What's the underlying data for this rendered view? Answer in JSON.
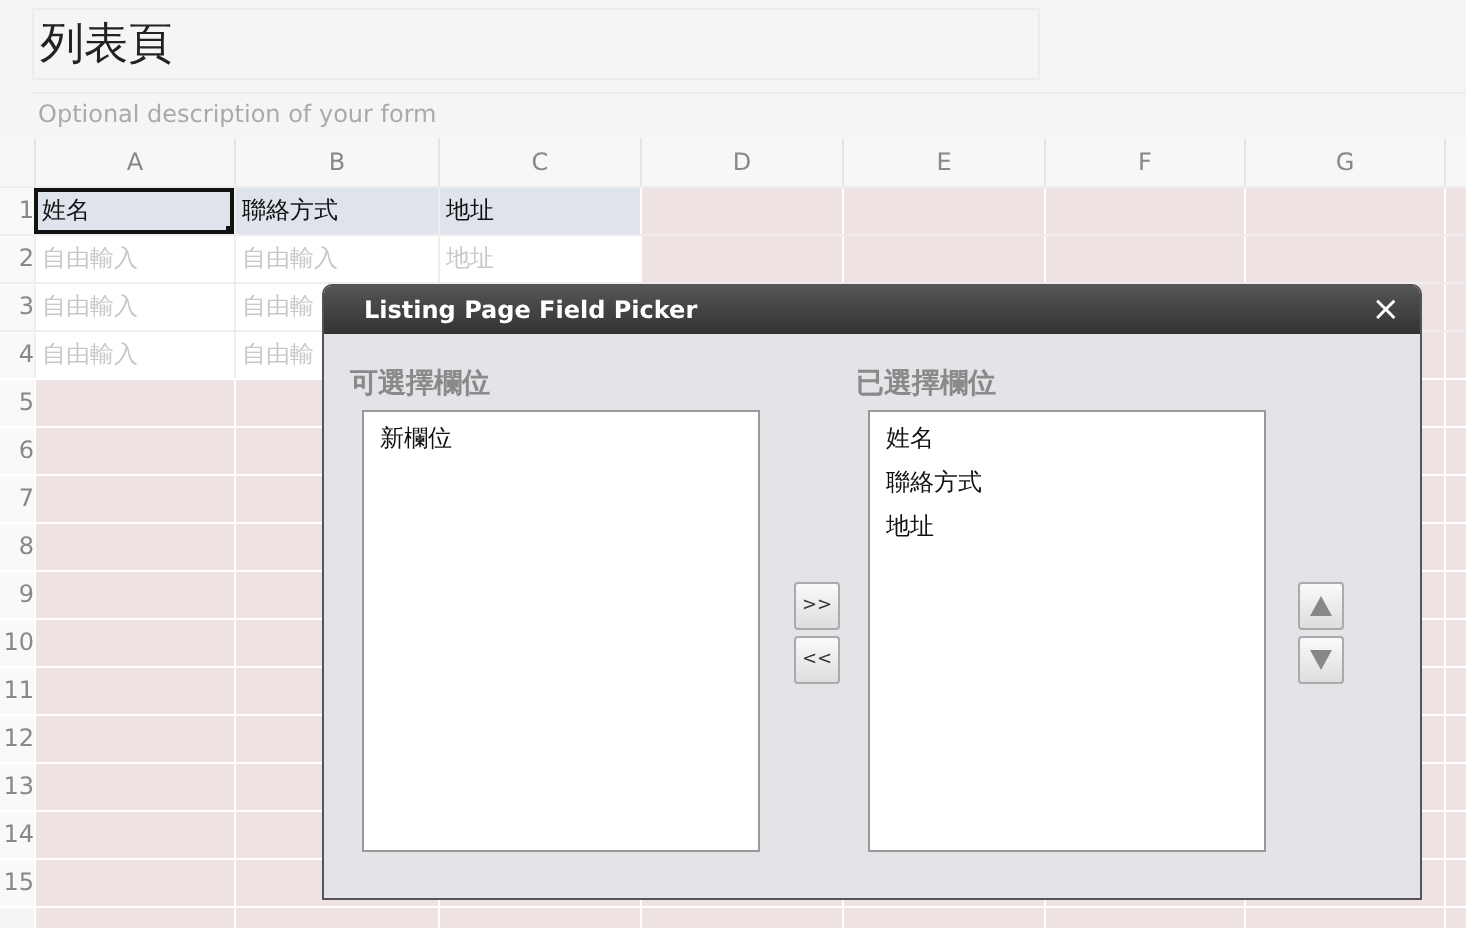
{
  "form": {
    "title": "列表頁",
    "description": "Optional description of your form"
  },
  "sheet": {
    "columns": [
      "A",
      "B",
      "C",
      "D",
      "E",
      "F",
      "G"
    ],
    "rows": [
      {
        "number": "1",
        "kind": "header",
        "cells": [
          {
            "text": "姓名",
            "selected": true
          },
          {
            "text": "聯絡方式",
            "selected": false
          },
          {
            "text": "地址",
            "selected": false
          }
        ]
      },
      {
        "number": "2",
        "kind": "hint",
        "cells": [
          {
            "text": "自由輸入",
            "selected": false
          },
          {
            "text": "自由輸入",
            "selected": false
          },
          {
            "text": "地址",
            "selected": false
          }
        ]
      },
      {
        "number": "3",
        "kind": "hint",
        "cells": [
          {
            "text": "自由輸入",
            "selected": false
          },
          {
            "text": "自由輸",
            "selected": false
          }
        ]
      },
      {
        "number": "4",
        "kind": "hint",
        "cells": [
          {
            "text": "自由輸入",
            "selected": false
          },
          {
            "text": "自由輸",
            "selected": false
          }
        ]
      },
      {
        "number": "5"
      },
      {
        "number": "6"
      },
      {
        "number": "7"
      },
      {
        "number": "8"
      },
      {
        "number": "9"
      },
      {
        "number": "10"
      },
      {
        "number": "11"
      },
      {
        "number": "12"
      },
      {
        "number": "13"
      },
      {
        "number": "14"
      },
      {
        "number": "15"
      }
    ]
  },
  "dialog": {
    "title": "Listing Page Field Picker",
    "close": "×",
    "available": {
      "label": "可選擇欄位",
      "items": [
        "新欄位"
      ]
    },
    "move_buttons": [
      ">>",
      "<<"
    ],
    "selected": {
      "label": "已選擇欄位",
      "items": [
        "姓名",
        "聯絡方式",
        "地址"
      ]
    }
  }
}
